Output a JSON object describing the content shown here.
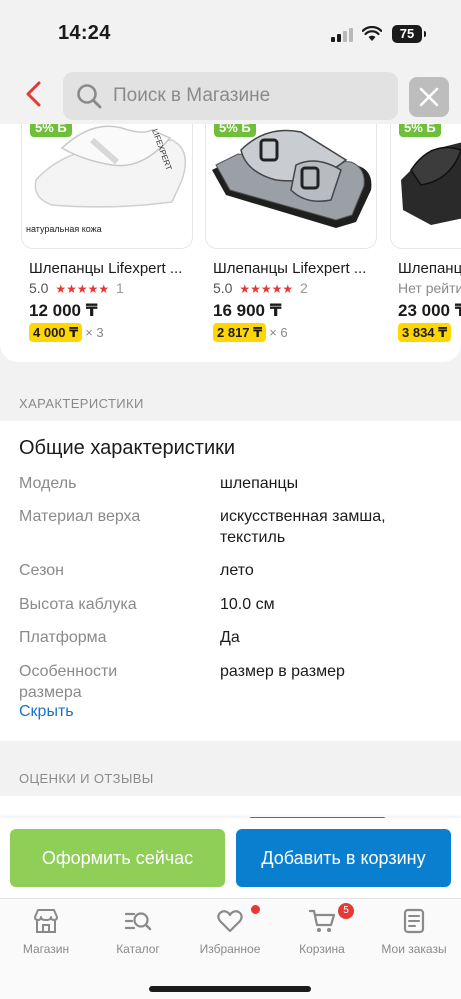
{
  "status_bar": {
    "time": "14:24",
    "battery": "75"
  },
  "header": {
    "search_placeholder": "Поиск в Магазине"
  },
  "products": [
    {
      "badge": "5% Б",
      "image_note": "натуральная кожа",
      "title": "Шлепанцы Lifexpert ...",
      "rating": "5.0",
      "reviews": "1",
      "price": "12 000 ₸",
      "installment": "4 000 ₸",
      "multiplier": "× 3"
    },
    {
      "badge": "5% Б",
      "image_note": "",
      "title": "Шлепанцы Lifexpert ...",
      "rating": "5.0",
      "reviews": "2",
      "price": "16 900 ₸",
      "installment": "2 817 ₸",
      "multiplier": "× 6"
    },
    {
      "badge": "5% Б",
      "image_note": "",
      "title": "Шлепанцы",
      "rating": "Нет рейти",
      "reviews": "",
      "price": "23 000 ₸",
      "installment": "3 834 ₸",
      "multiplier": ""
    }
  ],
  "specs": {
    "section_label": "ХАРАКТЕРИСТИКИ",
    "heading": "Общие характеристики",
    "rows": [
      {
        "key": "Модель",
        "value": "шлепанцы"
      },
      {
        "key": "Материал верха",
        "value": "искусственная замша, текстиль"
      },
      {
        "key": "Сезон",
        "value": "лето"
      },
      {
        "key": "Высота каблука",
        "value": "10.0 см"
      },
      {
        "key": "Платформа",
        "value": "Да"
      },
      {
        "key": "Особенности размера",
        "value": "размер в размер"
      }
    ],
    "hide_link": "Скрыть"
  },
  "reviews": {
    "section_label": "ОЦЕНКИ И ОТЗЫВЫ"
  },
  "actions": {
    "buy_now": "Оформить сейчас",
    "add_to_cart": "Добавить в корзину"
  },
  "tabbar": {
    "items": [
      {
        "label": "Магазин",
        "icon": "shop-icon"
      },
      {
        "label": "Каталог",
        "icon": "catalog-search-icon"
      },
      {
        "label": "Избранное",
        "icon": "heart-icon"
      },
      {
        "label": "Корзина",
        "icon": "cart-icon"
      },
      {
        "label": "Мои заказы",
        "icon": "orders-icon"
      }
    ],
    "cart_count": "5"
  },
  "colors": {
    "accent_blue": "#0a7fd0",
    "buy_green": "#8fce57",
    "badge_green": "#6fbf3b",
    "star_red": "#e53935",
    "installment_yellow": "#ffd600"
  }
}
